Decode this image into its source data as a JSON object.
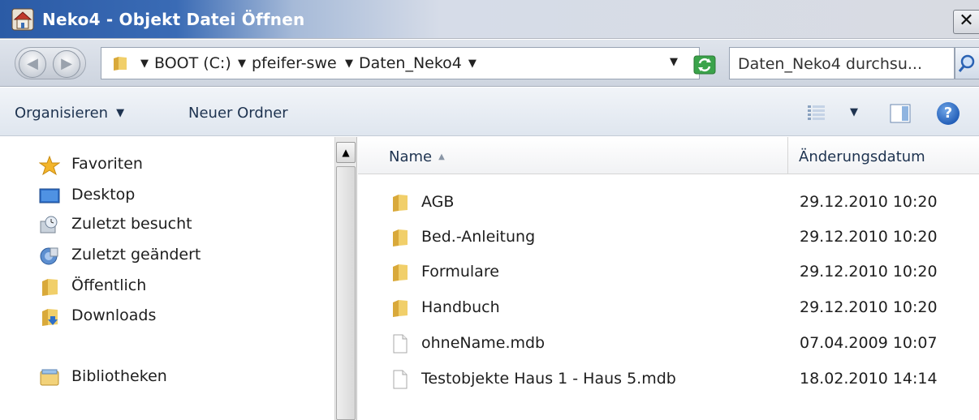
{
  "window": {
    "title": "Neko4 - Objekt Datei Öffnen",
    "close_glyph": "✕"
  },
  "addressbar": {
    "breadcrumbs": [
      "BOOT (C:)",
      "pfeifer-swe",
      "Daten_Neko4"
    ],
    "search_placeholder": "Daten_Neko4 durchsu..."
  },
  "toolbar": {
    "organize_label": "Organisieren",
    "new_folder_label": "Neuer Ordner",
    "help_glyph": "?"
  },
  "navigation": {
    "items": [
      {
        "label": "Favoriten",
        "icon": "star-icon"
      },
      {
        "label": "Desktop",
        "icon": "desktop-icon"
      },
      {
        "label": "Zuletzt besucht",
        "icon": "recent-places-icon"
      },
      {
        "label": "Zuletzt geändert",
        "icon": "recently-changed-icon"
      },
      {
        "label": "Öffentlich",
        "icon": "folder-icon"
      },
      {
        "label": "Downloads",
        "icon": "downloads-folder-icon"
      },
      {
        "label": "Bibliotheken",
        "icon": "libraries-icon"
      }
    ]
  },
  "filelist": {
    "columns": {
      "name": "Name",
      "date": "Änderungsdatum"
    },
    "rows": [
      {
        "name": "AGB",
        "date": "29.12.2010 10:20",
        "type": "folder"
      },
      {
        "name": "Bed.-Anleitung",
        "date": "29.12.2010 10:20",
        "type": "folder"
      },
      {
        "name": "Formulare",
        "date": "29.12.2010 10:20",
        "type": "folder"
      },
      {
        "name": "Handbuch",
        "date": "29.12.2010 10:20",
        "type": "folder"
      },
      {
        "name": "ohneName.mdb",
        "date": "07.04.2009 10:07",
        "type": "file"
      },
      {
        "name": "Testobjekte Haus 1 - Haus 5.mdb",
        "date": "18.02.2010 14:14",
        "type": "file"
      }
    ]
  },
  "colors": {
    "titlebar_blue": "#2b5ba6",
    "folder_yellow": "#e8c35a",
    "toolbar_text": "#1e3350"
  }
}
